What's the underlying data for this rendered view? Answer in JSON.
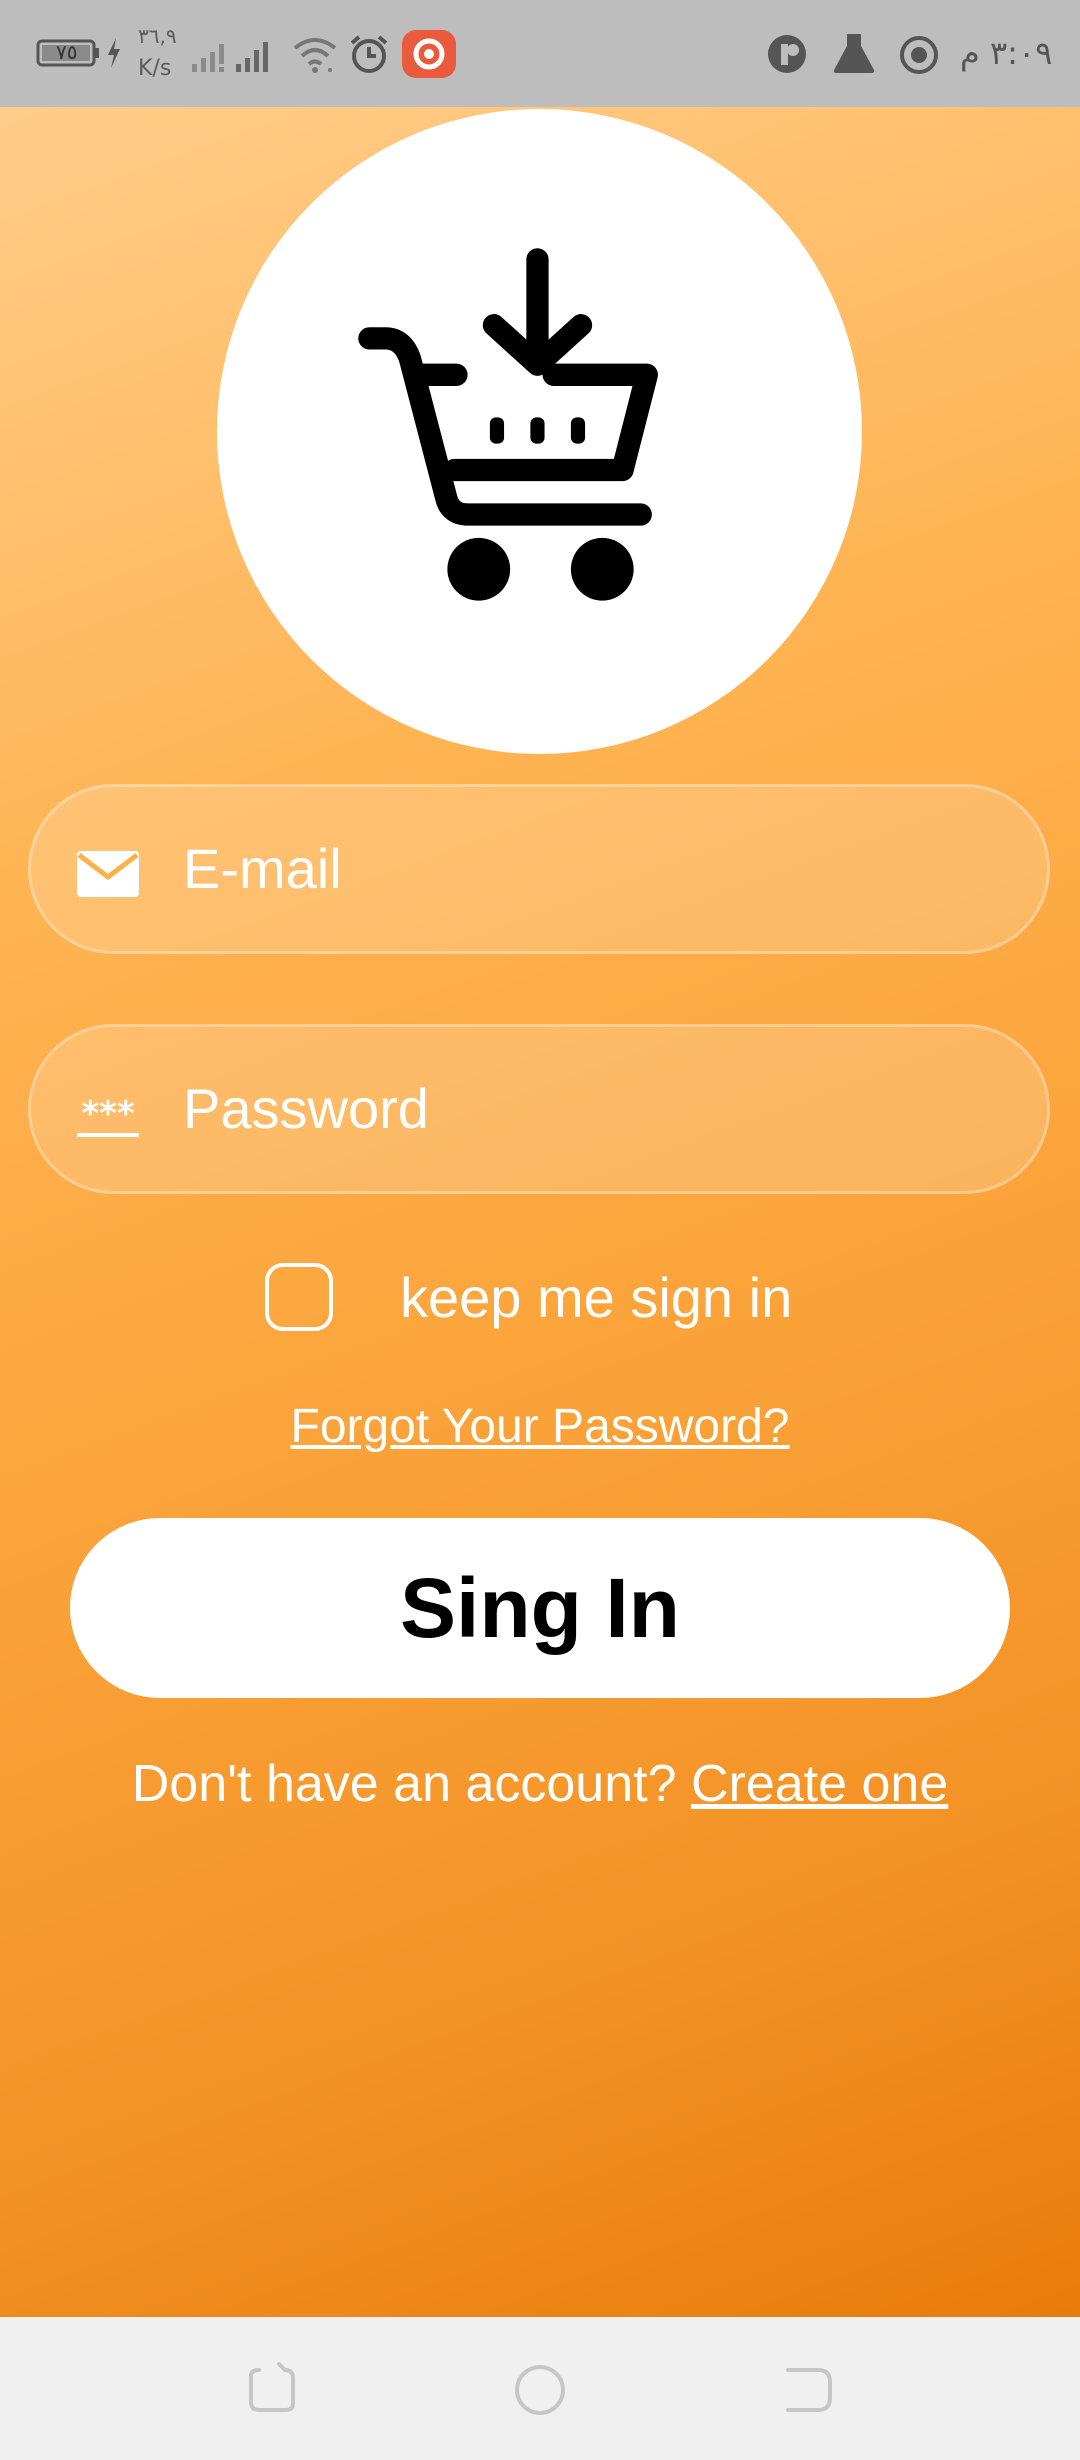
{
  "status_bar": {
    "battery": "٧٥",
    "net_speed_value": "٣٦,٩",
    "net_speed_unit": "K/s",
    "time": "٣:٠٩ م"
  },
  "login": {
    "email_placeholder": "E-mail",
    "password_placeholder": "Password",
    "keep_signed_in_label": "keep me sign in",
    "forgot_password_label": "Forgot Your Password?",
    "signin_label": "Sing In",
    "no_account_text": "Don't have an account?",
    "create_account_label": "Create one"
  },
  "icons": {
    "logo": "shopping-cart-download-icon",
    "email": "envelope-icon",
    "password": "asterisks-password-icon"
  },
  "colors": {
    "gradient_top": "#ffcd8a",
    "gradient_bottom": "#e87c0a",
    "button_bg": "#ffffff",
    "text": "#ffffff"
  }
}
